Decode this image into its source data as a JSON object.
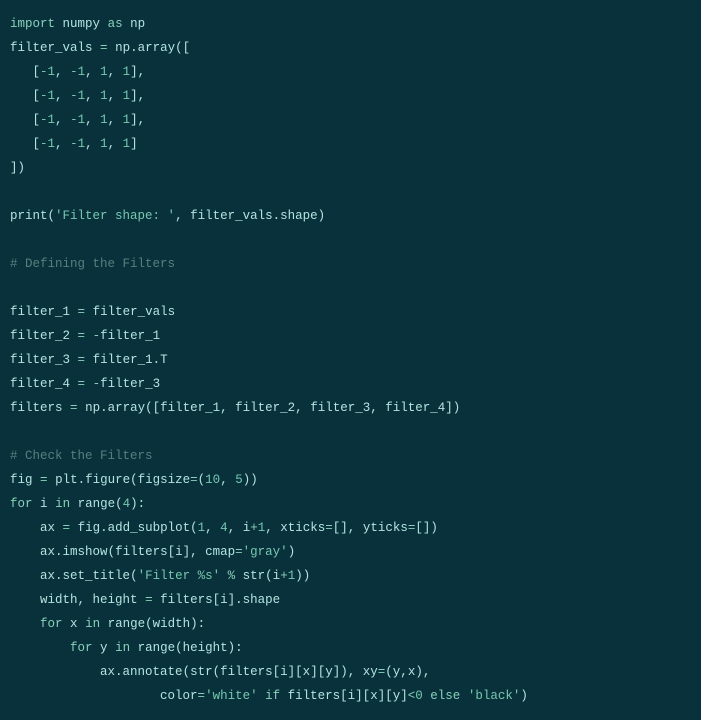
{
  "code": {
    "l1": {
      "kw1": "import",
      "sp1": " ",
      "id1": "numpy",
      "sp2": " ",
      "kw2": "as",
      "sp3": " ",
      "id2": "np"
    },
    "l2": {
      "id1": "filter_vals",
      "sp1": " ",
      "op1": "=",
      "sp2": " ",
      "id2": "np",
      "punc1": ".",
      "id3": "array",
      "punc2": "(["
    },
    "l3": {
      "ind": "   ",
      "punc1": "[",
      "num1": "-1",
      "c1": ", ",
      "num2": "-1",
      "c2": ", ",
      "num3": "1",
      "c3": ", ",
      "num4": "1",
      "punc2": "],"
    },
    "l4": {
      "ind": "   ",
      "punc1": "[",
      "num1": "-1",
      "c1": ", ",
      "num2": "-1",
      "c2": ", ",
      "num3": "1",
      "c3": ", ",
      "num4": "1",
      "punc2": "],"
    },
    "l5": {
      "ind": "   ",
      "punc1": "[",
      "num1": "-1",
      "c1": ", ",
      "num2": "-1",
      "c2": ", ",
      "num3": "1",
      "c3": ", ",
      "num4": "1",
      "punc2": "],"
    },
    "l6": {
      "ind": "   ",
      "punc1": "[",
      "num1": "-1",
      "c1": ", ",
      "num2": "-1",
      "c2": ", ",
      "num3": "1",
      "c3": ", ",
      "num4": "1",
      "punc2": "]"
    },
    "l7": {
      "punc1": "])"
    },
    "l8": "",
    "l9": {
      "fn1": "print",
      "punc1": "(",
      "str1": "'Filter shape: '",
      "c1": ", ",
      "id1": "filter_vals",
      "punc2": ".",
      "id2": "shape",
      "punc3": ")"
    },
    "l10": "",
    "l11": {
      "com": "# Defining the Filters"
    },
    "l12": "",
    "l13": {
      "id1": "filter_1",
      "sp1": " ",
      "op1": "=",
      "sp2": " ",
      "id2": "filter_vals"
    },
    "l14": {
      "id1": "filter_2",
      "sp1": " ",
      "op1": "=",
      "sp2": " ",
      "op2": "-",
      "id2": "filter_1"
    },
    "l15": {
      "id1": "filter_3",
      "sp1": " ",
      "op1": "=",
      "sp2": " ",
      "id2": "filter_1",
      "punc1": ".",
      "id3": "T"
    },
    "l16": {
      "id1": "filter_4",
      "sp1": " ",
      "op1": "=",
      "sp2": " ",
      "op2": "-",
      "id2": "filter_3"
    },
    "l17": {
      "id1": "filters",
      "sp1": " ",
      "op1": "=",
      "sp2": " ",
      "id2": "np",
      "punc1": ".",
      "id3": "array",
      "punc2": "([",
      "id4": "filter_1",
      "c1": ", ",
      "id5": "filter_2",
      "c2": ", ",
      "id6": "filter_3",
      "c3": ", ",
      "id7": "filter_4",
      "punc3": "])"
    },
    "l18": "",
    "l19": {
      "com": "# Check the Filters"
    },
    "l20": {
      "id1": "fig",
      "sp1": " ",
      "op1": "=",
      "sp2": " ",
      "id2": "plt",
      "punc1": ".",
      "id3": "figure",
      "punc2": "(",
      "id4": "figsize",
      "op2": "=",
      "punc3": "(",
      "num1": "10",
      "c1": ", ",
      "num2": "5",
      "punc4": "))"
    },
    "l21": {
      "kw1": "for",
      "sp1": " ",
      "id1": "i",
      "sp2": " ",
      "kw2": "in",
      "sp3": " ",
      "fn1": "range",
      "punc1": "(",
      "num1": "4",
      "punc2": "):"
    },
    "l22": {
      "ind": "    ",
      "id1": "ax",
      "sp1": " ",
      "op1": "=",
      "sp2": " ",
      "id2": "fig",
      "punc1": ".",
      "id3": "add_subplot",
      "punc2": "(",
      "num1": "1",
      "c1": ", ",
      "num2": "4",
      "c2": ", ",
      "id4": "i",
      "op2": "+",
      "num3": "1",
      "c3": ", ",
      "id5": "xticks",
      "op3": "=",
      "punc3": "[], ",
      "id6": "yticks",
      "op4": "=",
      "punc4": "[])"
    },
    "l23": {
      "ind": "    ",
      "id1": "ax",
      "punc1": ".",
      "id2": "imshow",
      "punc2": "(",
      "id3": "filters",
      "punc3": "[",
      "id4": "i",
      "punc4": "], ",
      "id5": "cmap",
      "op1": "=",
      "str1": "'gray'",
      "punc5": ")"
    },
    "l24": {
      "ind": "    ",
      "id1": "ax",
      "punc1": ".",
      "id2": "set_title",
      "punc2": "(",
      "str1": "'Filter %s'",
      "sp1": " ",
      "op1": "%",
      "sp2": " ",
      "fn1": "str",
      "punc3": "(",
      "id3": "i",
      "op2": "+",
      "num1": "1",
      "punc4": "))"
    },
    "l25": {
      "ind": "    ",
      "id1": "width",
      "c1": ", ",
      "id2": "height",
      "sp1": " ",
      "op1": "=",
      "sp2": " ",
      "id3": "filters",
      "punc1": "[",
      "id4": "i",
      "punc2": "].",
      "id5": "shape"
    },
    "l26": {
      "ind": "    ",
      "kw1": "for",
      "sp1": " ",
      "id1": "x",
      "sp2": " ",
      "kw2": "in",
      "sp3": " ",
      "fn1": "range",
      "punc1": "(",
      "id2": "width",
      "punc2": "):"
    },
    "l27": {
      "ind": "        ",
      "kw1": "for",
      "sp1": " ",
      "id1": "y",
      "sp2": " ",
      "kw2": "in",
      "sp3": " ",
      "fn1": "range",
      "punc1": "(",
      "id2": "height",
      "punc2": "):"
    },
    "l28": {
      "ind": "            ",
      "id1": "ax",
      "punc1": ".",
      "id2": "annotate",
      "punc2": "(",
      "fn1": "str",
      "punc3": "(",
      "id3": "filters",
      "punc4": "[",
      "id4": "i",
      "punc5": "][",
      "id5": "x",
      "punc6": "][",
      "id6": "y",
      "punc7": "]), ",
      "id7": "xy",
      "op1": "=",
      "punc8": "(",
      "id8": "y",
      "c1": ",",
      "id9": "x",
      "punc9": "),"
    },
    "l29": {
      "ind": "                    ",
      "id1": "color",
      "op1": "=",
      "str1": "'white'",
      "sp1": " ",
      "kw1": "if",
      "sp2": " ",
      "id2": "filters",
      "punc1": "[",
      "id3": "i",
      "punc2": "][",
      "id4": "x",
      "punc3": "][",
      "id5": "y",
      "punc4": "]",
      "op2": "<",
      "num1": "0",
      "sp3": " ",
      "kw2": "else",
      "sp4": " ",
      "str2": "'black'",
      "punc5": ")"
    }
  }
}
